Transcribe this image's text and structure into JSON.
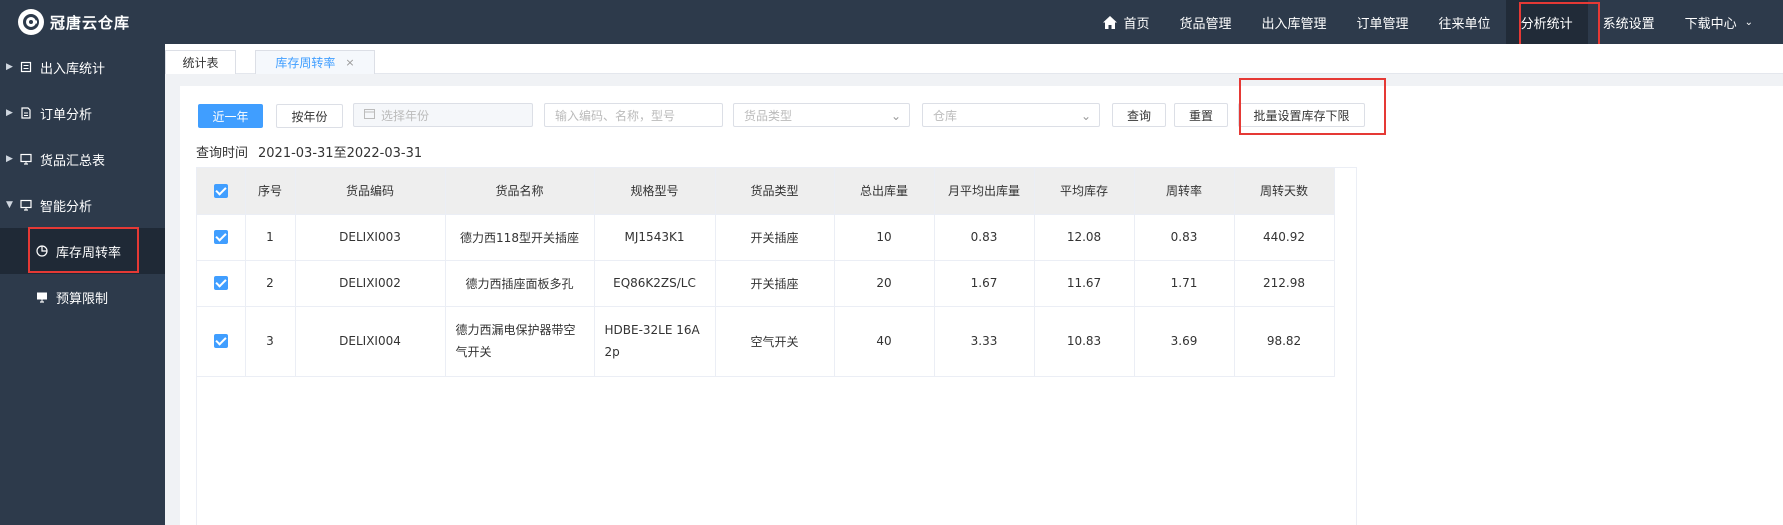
{
  "app": {
    "logo_text": "冠唐云仓库"
  },
  "topnav": {
    "items": [
      {
        "label": "首页",
        "name": "nav-home"
      },
      {
        "label": "货品管理",
        "name": "nav-goods"
      },
      {
        "label": "出入库管理",
        "name": "nav-inout"
      },
      {
        "label": "订单管理",
        "name": "nav-orders"
      },
      {
        "label": "往来单位",
        "name": "nav-partners"
      },
      {
        "label": "分析统计",
        "name": "nav-analysis"
      },
      {
        "label": "系统设置",
        "name": "nav-settings"
      },
      {
        "label": "下载中心",
        "name": "nav-download"
      }
    ],
    "active": "分析统计"
  },
  "sidebar": {
    "items": [
      {
        "label": "出入库统计",
        "icon": "list-icon"
      },
      {
        "label": "订单分析",
        "icon": "document-icon"
      },
      {
        "label": "货品汇总表",
        "icon": "monitor-icon"
      },
      {
        "label": "智能分析",
        "icon": "monitor-icon",
        "expanded": true
      }
    ],
    "subitems": [
      {
        "label": "库存周转率",
        "icon": "pie-chart-icon",
        "active": true
      },
      {
        "label": "预算限制",
        "icon": "monitor-icon"
      }
    ]
  },
  "tabs": [
    {
      "label": "统计表"
    },
    {
      "label": "库存周转率",
      "active": true,
      "close": "×"
    }
  ],
  "toolbar": {
    "recent_year": "近一年",
    "by_year": "按年份",
    "year_placeholder": "选择年份",
    "search_placeholder": "输入编码、名称，型号",
    "category_placeholder": "货品类型",
    "warehouse_placeholder": "仓库",
    "query": "查询",
    "reset": "重置",
    "batch_set": "批量设置库存下限"
  },
  "query_time": {
    "label": "查询时间",
    "value": "2021-03-31至2022-03-31"
  },
  "table": {
    "headers": [
      "序号",
      "货品编码",
      "货品名称",
      "规格型号",
      "货品类型",
      "总出库量",
      "月平均出库量",
      "平均库存",
      "周转率",
      "周转天数"
    ],
    "rows": [
      {
        "no": "1",
        "code": "DELIXI003",
        "name": "德力西118型开关插座",
        "spec": "MJ1543K1",
        "type": "开关插座",
        "total_out": "10",
        "monthly_avg_out": "0.83",
        "avg_stock": "12.08",
        "turnover": "0.83",
        "turnover_days": "440.92"
      },
      {
        "no": "2",
        "code": "DELIXI002",
        "name": "德力西插座面板多孔",
        "spec": "EQ86K2ZS/LC",
        "type": "开关插座",
        "total_out": "20",
        "monthly_avg_out": "1.67",
        "avg_stock": "11.67",
        "turnover": "1.71",
        "turnover_days": "212.98"
      },
      {
        "no": "3",
        "code": "DELIXI004",
        "name": "德力西漏电保护器带空气开关",
        "spec": "HDBE-32LE 16A 2p",
        "type": "空气开关",
        "total_out": "40",
        "monthly_avg_out": "3.33",
        "avg_stock": "10.83",
        "turnover": "3.69",
        "turnover_days": "98.82"
      }
    ]
  },
  "colors": {
    "header_bg": "#2d3a4b",
    "accent": "#409eff",
    "highlight": "#e53935"
  }
}
